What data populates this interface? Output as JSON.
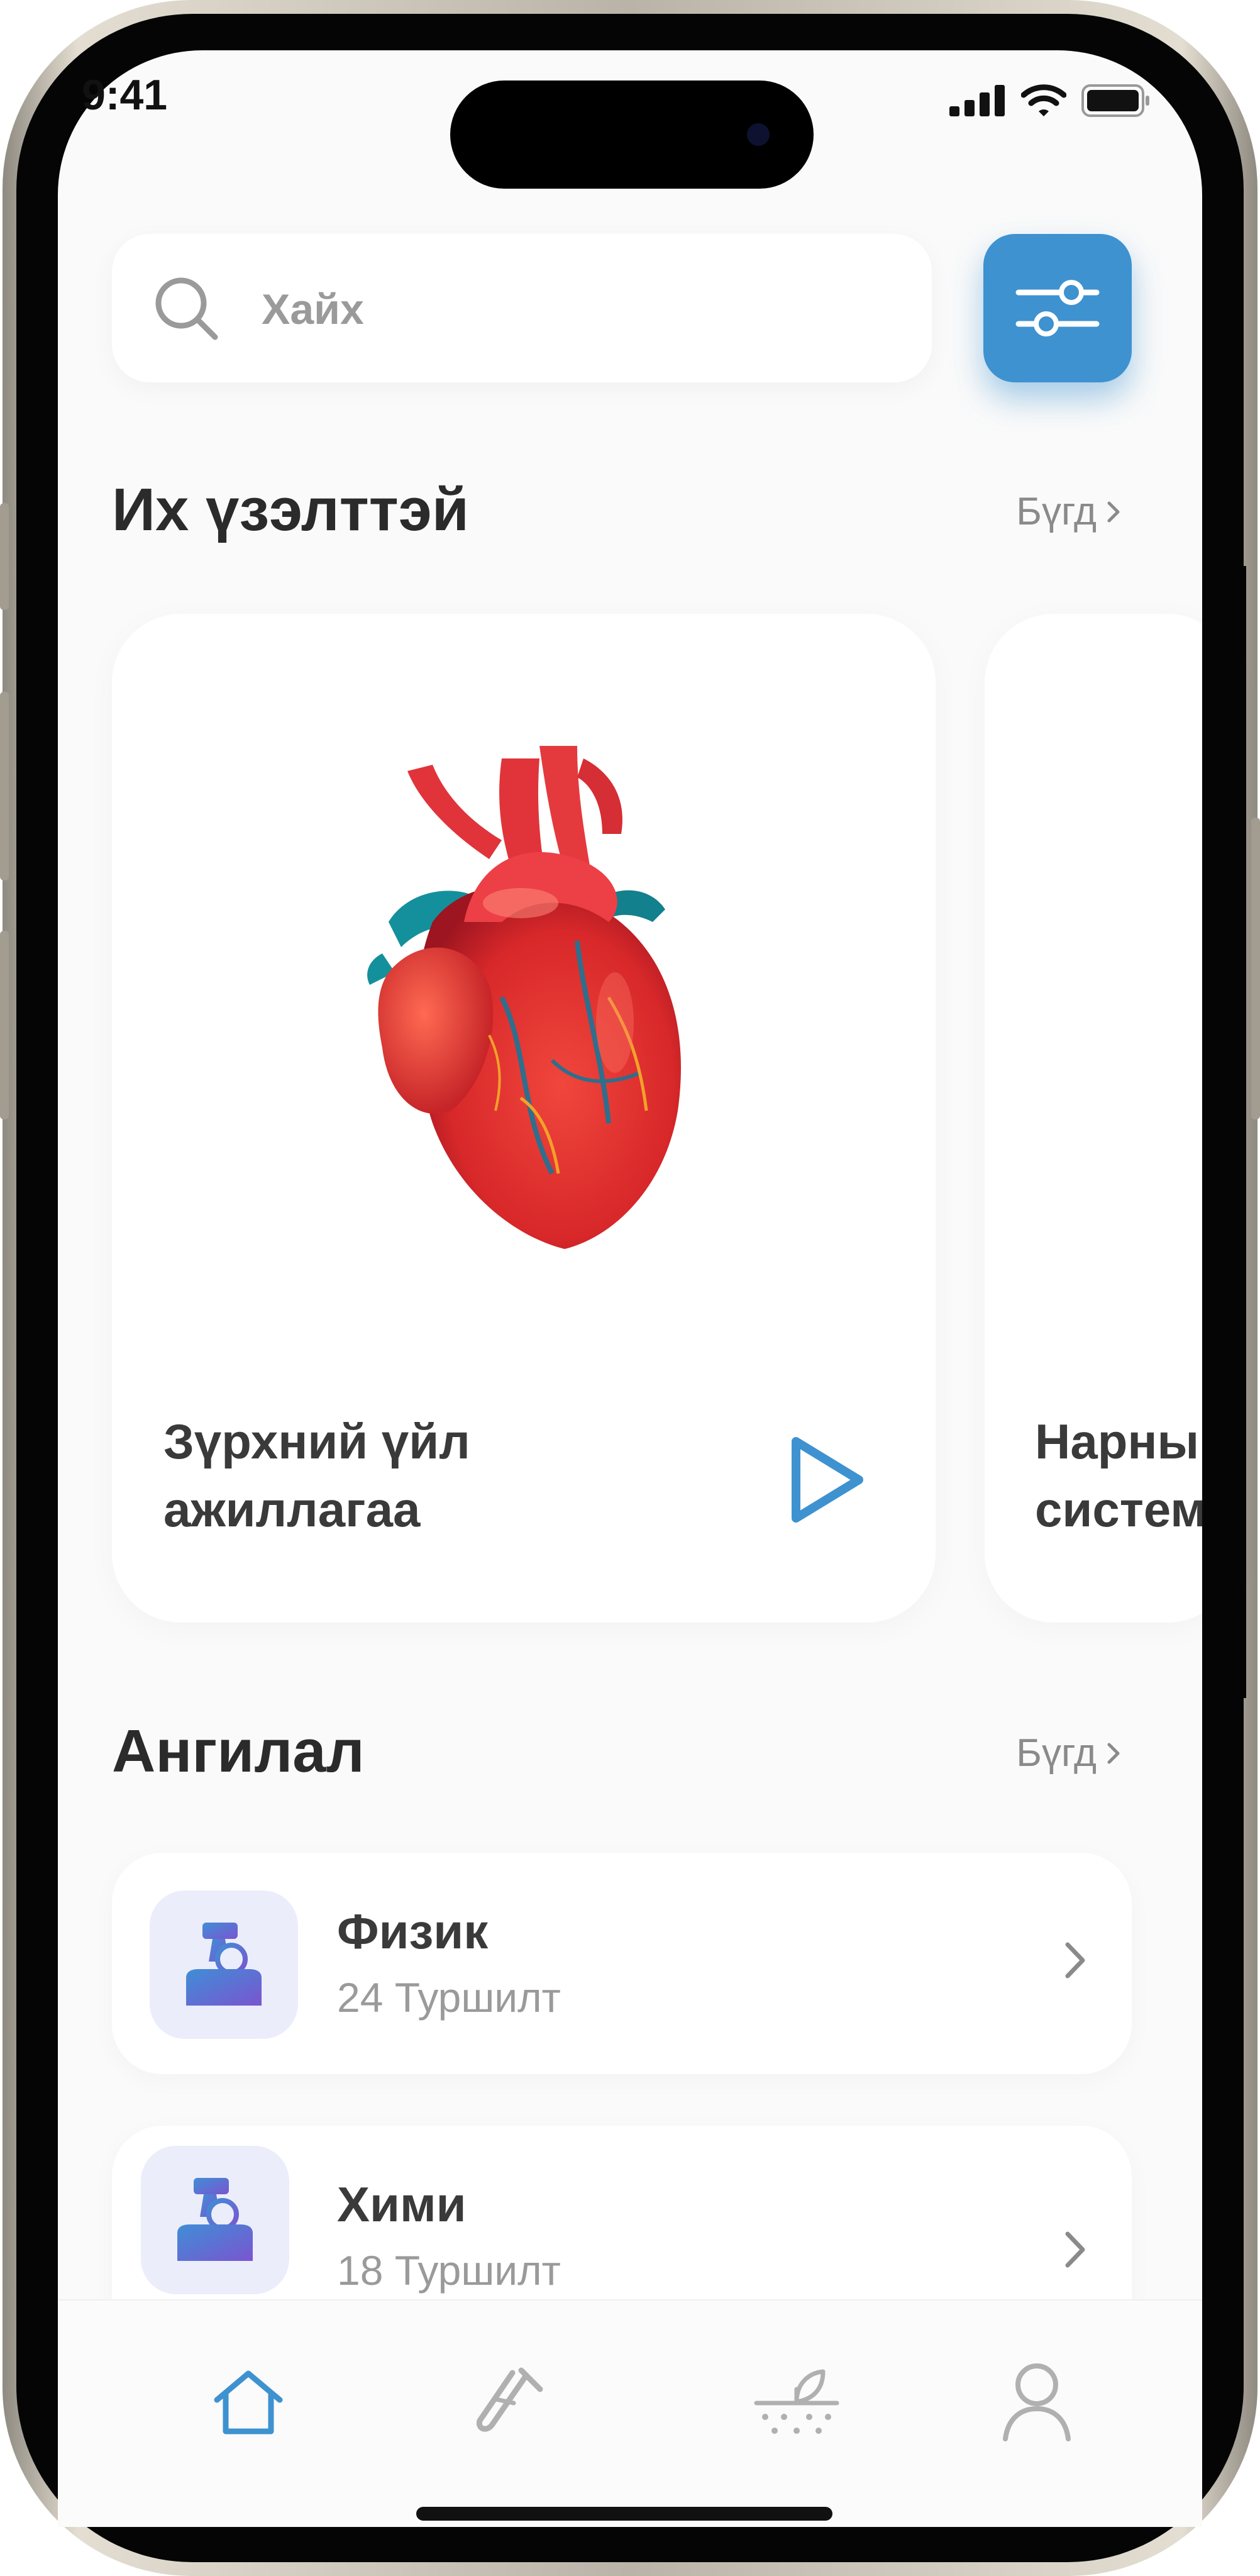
{
  "status_bar": {
    "time": "9:41"
  },
  "search": {
    "placeholder": "Хайх"
  },
  "popular": {
    "title": "Их үзэлттэй",
    "see_all": "Бүгд",
    "cards": [
      {
        "title_line1": "Зүрхний үйл",
        "title_line2": "ажиллагаа"
      },
      {
        "title_line1": "Нарны",
        "title_line2": "систем"
      }
    ]
  },
  "categories": {
    "title": "Ангилал",
    "see_all": "Бүгд",
    "items": [
      {
        "name": "Физик",
        "count": "24 Туршилт"
      },
      {
        "name": "Хими",
        "count": "18 Туршилт"
      }
    ]
  },
  "tabs": [
    "home-icon",
    "test-tube-icon",
    "plant-icon",
    "profile-icon"
  ],
  "colors": {
    "accent": "#3e92d0",
    "active_tab": "#3e92d0",
    "inactive_tab": "#b0b0b0"
  }
}
